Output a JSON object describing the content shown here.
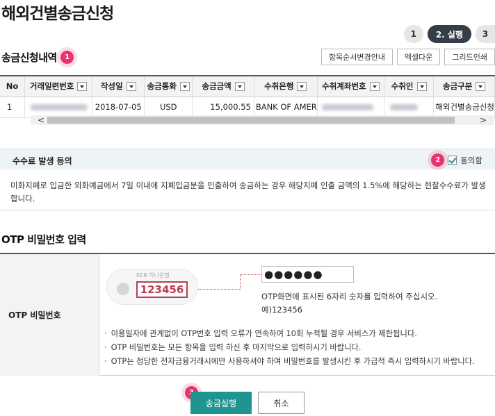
{
  "page": {
    "title": "해외건별송금신청"
  },
  "steps": [
    {
      "label": "1"
    },
    {
      "label": "2. 실행"
    },
    {
      "label": "3"
    }
  ],
  "remittance": {
    "title": "송금신청내역",
    "badge": "1",
    "toolbar": {
      "column_order_label": "항목순서변경안내",
      "excel_label": "엑셀다운",
      "print_label": "그리드인쇄"
    },
    "columns": [
      "No",
      "거래일련번호",
      "작성일",
      "송금통화",
      "송금금액",
      "수취은행",
      "수취계좌번호",
      "수취인",
      "송금구분"
    ],
    "rows": [
      {
        "no": "1",
        "date": "2018-07-05",
        "currency": "USD",
        "amount": "15,000.55",
        "bank": "BANK OF AMER",
        "type": "해외건별송금신청"
      }
    ],
    "scroll_left": "<",
    "scroll_right": ">"
  },
  "fee": {
    "title": "수수료 발생 동의",
    "badge": "2",
    "agree_label": "동의함",
    "text": "미화지폐로 입금한 외화예금에서 7일 이내에 지폐입금분을 인출하여 송금하는 경우 해당지폐 인출 금액의 1.5%에 해당하는 현찰수수료가 발생합니다."
  },
  "otp": {
    "title": "OTP 비밀번호 입력",
    "label": "OTP 비밀번호",
    "card_brand": "KEB 하나은행",
    "card_digits": "123456",
    "input_value": "●●●●●●",
    "hint": "OTP화면에 표시된 6자리 숫자를 입력하여 주십시오.",
    "example": "예)123456",
    "notices": [
      "이용일자에 관계없이 OTP번호 입력 오류가 연속하여 10회 누적될 경우 서비스가 제한됩니다.",
      "OTP 비밀번호는 모든 항목을 입력 하신 후 마지막으로 입력하시기 바랍니다.",
      "OTP는 정당한 전자금융거래시에만 사용하셔야 하며 비밀번호를 발생시킨 후 가급적 즉시 입력하시기 바랍니다."
    ]
  },
  "actions": {
    "badge": "3",
    "submit_label": "송금실행",
    "cancel_label": "취소"
  },
  "colors": {
    "accent": "#1f9490",
    "badge": "#e8326d",
    "step_active": "#343d48"
  }
}
